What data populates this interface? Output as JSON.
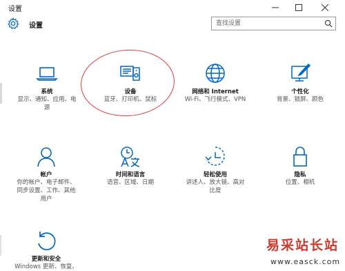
{
  "window": {
    "title": "设置",
    "controls": {
      "minimize": "minimize-icon",
      "maximize": "maximize-icon",
      "close": "close-icon"
    }
  },
  "header": {
    "title": "设置",
    "icon": "gear-icon"
  },
  "search": {
    "placeholder": "查找设置",
    "icon": "search-icon"
  },
  "categories": [
    {
      "name": "系统",
      "desc": [
        "显示、通知、应用、电",
        "源"
      ],
      "icon": "laptop-icon"
    },
    {
      "name": "设备",
      "desc": [
        "蓝牙、打印机、鼠标"
      ],
      "icon": "devices-icon"
    },
    {
      "name": "网络和 Internet",
      "desc": [
        "Wi-Fi、飞行模式、VPN"
      ],
      "icon": "globe-icon"
    },
    {
      "name": "个性化",
      "desc": [
        "背景、锁屏、颜色"
      ],
      "icon": "personalization-icon"
    },
    {
      "name": "帐户",
      "desc": [
        "你的帐户、电子邮件、",
        "同步设置、工作、其他",
        "用户"
      ],
      "icon": "person-icon"
    },
    {
      "name": "时间和语言",
      "desc": [
        "语音、区域、日期"
      ],
      "icon": "time-language-icon"
    },
    {
      "name": "轻松使用",
      "desc": [
        "讲述人、放大镜、高对",
        "比度"
      ],
      "icon": "ease-of-access-icon"
    },
    {
      "name": "隐私",
      "desc": [
        "位置、相机"
      ],
      "icon": "lock-icon"
    },
    {
      "name": "更新和安全",
      "desc": [
        "Windows 更新、恢复、"
      ],
      "icon": "update-icon"
    }
  ],
  "highlight": {
    "target": "设备",
    "color": "#e03a3a"
  },
  "watermark": {
    "text": "易采站长站",
    "url": "www.easck.com",
    "color": "#d2362c"
  },
  "colors": {
    "accent": "#0067c0",
    "background": "#ffffff"
  }
}
